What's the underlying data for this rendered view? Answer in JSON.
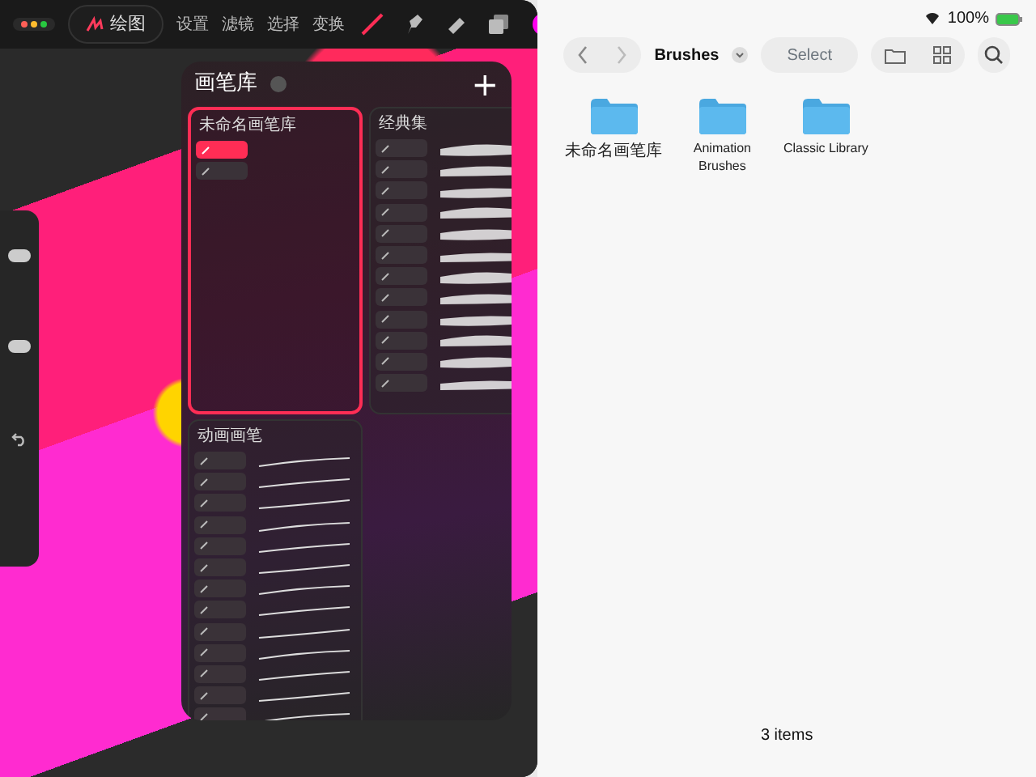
{
  "toolbar": {
    "gallery_label": "绘图",
    "menus": [
      "设置",
      "滤镜",
      "选择",
      "变换"
    ],
    "tools": [
      {
        "kind": "brush",
        "selected": true
      },
      {
        "kind": "smudge",
        "selected": false
      },
      {
        "kind": "eraser",
        "selected": false
      },
      {
        "kind": "layers",
        "selected": false
      }
    ]
  },
  "brush_library": {
    "title": "画笔库",
    "add_label": "+",
    "groups": [
      {
        "title": "未命名画笔库",
        "kind": "custom",
        "selected": true,
        "items": [
          {
            "selected": true
          },
          {
            "selected": false
          }
        ]
      },
      {
        "title": "经典集",
        "kind": "classic",
        "selected": false,
        "items": [
          {
            "selected": false
          },
          {
            "selected": false
          },
          {
            "selected": false
          },
          {
            "selected": false
          },
          {
            "selected": false
          },
          {
            "selected": false
          },
          {
            "selected": false
          },
          {
            "selected": false
          },
          {
            "selected": false
          },
          {
            "selected": false
          },
          {
            "selected": false
          },
          {
            "selected": false
          }
        ]
      },
      {
        "title": "动画画笔",
        "kind": "animation",
        "selected": false,
        "items": [
          {
            "selected": false
          },
          {
            "selected": false
          },
          {
            "selected": false
          },
          {
            "selected": false
          },
          {
            "selected": false
          },
          {
            "selected": false
          },
          {
            "selected": false
          },
          {
            "selected": false
          },
          {
            "selected": false
          },
          {
            "selected": false
          },
          {
            "selected": false
          },
          {
            "selected": false
          },
          {
            "selected": false
          }
        ]
      }
    ]
  },
  "files": {
    "battery": "100%",
    "title": "Brushes",
    "select_label": "Select",
    "folders": [
      {
        "name": "未命名画笔库"
      },
      {
        "name": "Animation Brushes"
      },
      {
        "name": "Classic Library"
      }
    ],
    "footer": "3 items"
  }
}
